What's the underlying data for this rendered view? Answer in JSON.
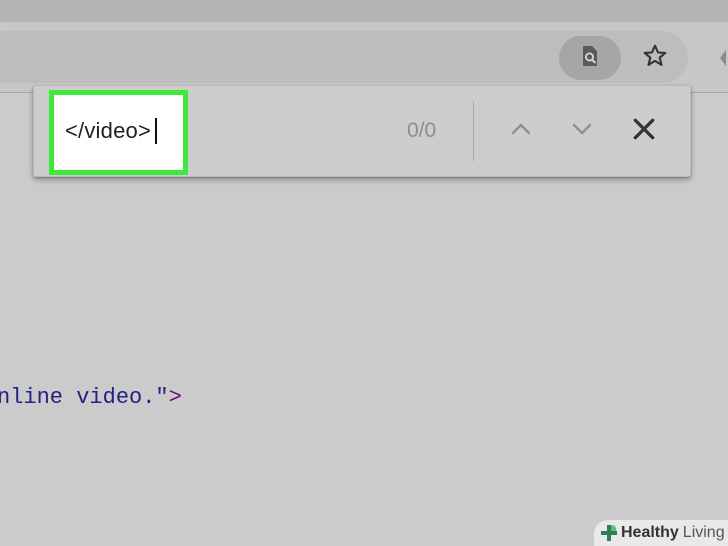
{
  "browser": {
    "toolbar": {
      "search_page_icon": "search-in-page-icon",
      "bookmark_icon": "star-icon"
    }
  },
  "find_bar": {
    "query": "</video>",
    "match_count": "0/0",
    "prev_icon": "chevron-up-icon",
    "next_icon": "chevron-down-icon",
    "close_icon": "close-icon",
    "highlight_color": "#3fe93b"
  },
  "page_source": {
    "visible_text": "nline video.\"",
    "tag_end": ">"
  },
  "watermark": {
    "brand_bold": "Healthy",
    "brand_regular": "Living"
  }
}
